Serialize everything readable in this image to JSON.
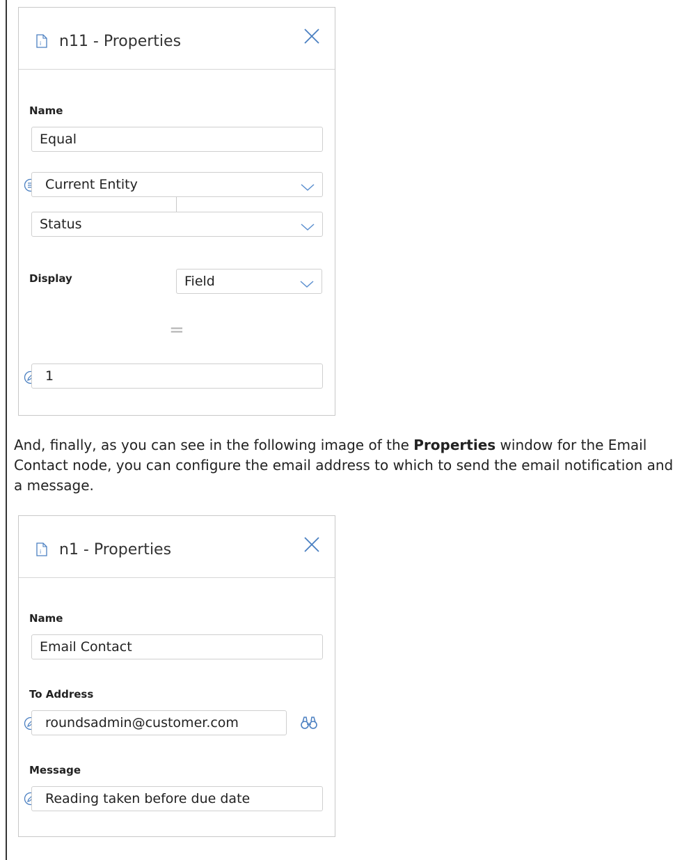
{
  "panel1": {
    "title": "n11 - Properties",
    "name_label": "Name",
    "name_value": "Equal",
    "entity_select": "Current Entity",
    "field_select": "Status",
    "display_label": "Display",
    "display_select": "Field",
    "operator_symbol": "=",
    "value_input": "1",
    "icons": [
      "document-icon",
      "close-icon",
      "list-icon",
      "chevron-down-icon",
      "edit-icon"
    ]
  },
  "paragraph": {
    "before_bold": "And, finally, as you can see in the following image of the ",
    "bold": "Properties",
    "after_bold": " window for the Email Contact node, you can configure the email address to which to send the email notification and a message."
  },
  "panel2": {
    "title": "n1 - Properties",
    "name_label": "Name",
    "name_value": "Email Contact",
    "to_address_label": "To Address",
    "to_address_value": "roundsadmin@customer.com",
    "message_label": "Message",
    "message_value": "Reading taken before due date",
    "icons": [
      "document-icon",
      "close-icon",
      "edit-icon",
      "binoculars-icon"
    ]
  },
  "colors": {
    "accent": "#4a7fc1",
    "border": "#cfcfcf",
    "chevron": "#5b8fcf"
  }
}
